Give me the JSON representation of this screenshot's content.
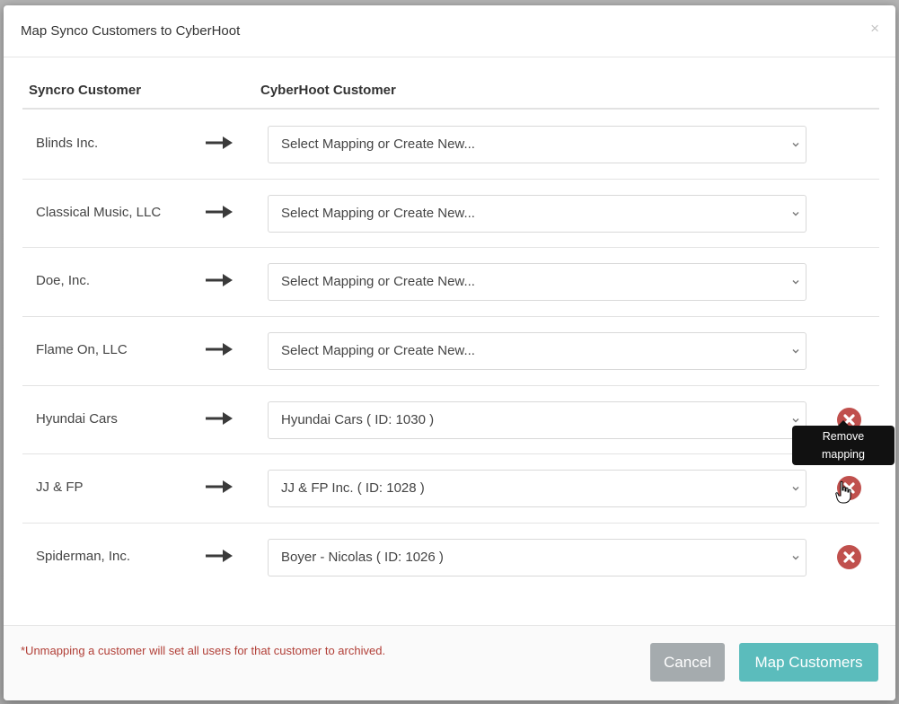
{
  "modal": {
    "title": "Map Synco Customers to CyberHoot",
    "close_label": "×"
  },
  "columns": {
    "syncro": "Syncro Customer",
    "cyberhoot": "CyberHoot Customer"
  },
  "rows": [
    {
      "customer": "Blinds Inc.",
      "mapping": "Select Mapping or Create New...",
      "has_remove": false
    },
    {
      "customer": "Classical Music, LLC",
      "mapping": "Select Mapping or Create New...",
      "has_remove": false
    },
    {
      "customer": "Doe, Inc.",
      "mapping": "Select Mapping or Create New...",
      "has_remove": false
    },
    {
      "customer": "Flame On, LLC",
      "mapping": "Select Mapping or Create New...",
      "has_remove": false
    },
    {
      "customer": "Hyundai Cars",
      "mapping": "Hyundai Cars ( ID: 1030 )",
      "has_remove": true
    },
    {
      "customer": "JJ & FP",
      "mapping": "JJ & FP Inc. ( ID: 1028 )",
      "has_remove": true
    },
    {
      "customer": "Spiderman, Inc.",
      "mapping": "Boyer - Nicolas ( ID: 1026 )",
      "has_remove": true
    }
  ],
  "tooltip": {
    "line1": "Remove",
    "line2": "mapping"
  },
  "footer": {
    "note": "*Unmapping a customer will set all users for that customer to archived.",
    "cancel_label": "Cancel",
    "map_label": "Map Customers"
  },
  "colors": {
    "remove": "#c0504d",
    "primary": "#5bbcbc",
    "cancel": "#a5abae",
    "note": "#b13f37"
  },
  "icons": {
    "arrow": "arrow-right-icon",
    "chevron": "chevron-down-icon",
    "remove": "remove-circle-icon",
    "cursor": "hand-pointer-icon"
  }
}
